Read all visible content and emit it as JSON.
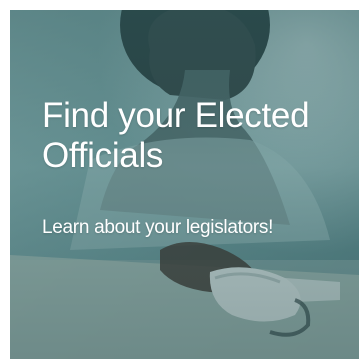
{
  "card": {
    "title": "Find your Elected Officials",
    "subtitle": "Learn about your legislators!"
  },
  "colors": {
    "overlay": "#3d6f70",
    "text": "#ffffff"
  }
}
